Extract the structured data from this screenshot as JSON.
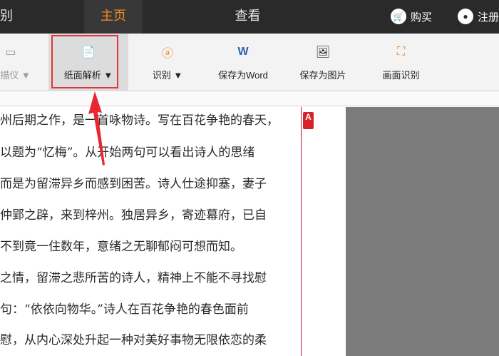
{
  "topbar": {
    "left_fragment": "别",
    "tabs": [
      {
        "label": "主页",
        "active": true
      },
      {
        "label": "查看",
        "active": false
      }
    ],
    "buy": "购买",
    "register": "注册"
  },
  "toolbar": {
    "items": [
      {
        "label": "扫描仪 ▼",
        "icon": "scanner-icon"
      },
      {
        "label": "纸面解析 ▼",
        "icon": "paper-analysis-icon"
      },
      {
        "label": "识别 ▼",
        "icon": "recognize-icon"
      },
      {
        "label": "保存为Word",
        "icon": "word-icon"
      },
      {
        "label": "保存为图片",
        "icon": "save-image-icon"
      },
      {
        "label": "画面识别",
        "icon": "screen-recognize-icon"
      }
    ]
  },
  "document": {
    "lines": [
      "州后期之作，是一首咏物诗。写在百花争艳的春天，",
      "以题为“忆梅”。从开始两句可以看出诗人的思绪",
      "而是为留滞异乡而感到困苦。诗人仕途抑塞，妻子",
      "仲郢之辟，来到梓州。独居异乡，寄迹幕府，已自",
      "不到竟一住数年，意绪之无聊郁闷可想而知。",
      "之情，留滞之悲所苦的诗人，精神上不能不寻找慰",
      "句：“依依向物华。”诗人在百花争艳的春色面前",
      "慰，从内心深处升起一种对美好事物无限依恋的柔"
    ],
    "annotation_icon": "A"
  },
  "colors": {
    "accent": "#f08a24",
    "highlight": "#e0353a"
  }
}
